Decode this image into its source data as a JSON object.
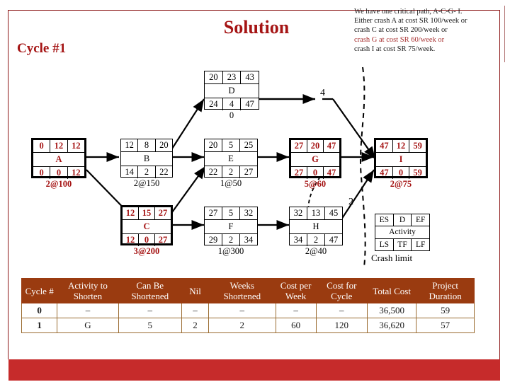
{
  "slide": {
    "title": "Solution",
    "cycle_label": "Cycle #1",
    "accent_red": "#a51414",
    "table_header_bg": "#9a3b10",
    "bottom_bar_color": "#c62b2b"
  },
  "note": {
    "line1": "We have one critical path, A-C-G- I.",
    "line2": "Either crash A at cost SR 100/week  or",
    "line3": "crash C  at cost SR 200/week or",
    "line4": "crash G  at cost SR 60/week or",
    "line5": "crash I at cost SR 75/week."
  },
  "legend": {
    "es": "ES",
    "d": "D",
    "ef": "EF",
    "activity": "Activity",
    "ls": "LS",
    "tf": "TF",
    "lf": "LF",
    "caption": "Crash limit"
  },
  "edge_labels": {
    "top": "4",
    "bottom": "2"
  },
  "nodes": [
    {
      "id": "D",
      "critical": false,
      "top": [
        "20",
        "23",
        "43"
      ],
      "name": "D",
      "bottom": [
        "24",
        "4",
        "47"
      ],
      "caption": "0"
    },
    {
      "id": "A",
      "critical": true,
      "top": [
        "0",
        "12",
        "12"
      ],
      "name": "A",
      "bottom": [
        "0",
        "0",
        "12"
      ],
      "caption": "2@100"
    },
    {
      "id": "B",
      "critical": false,
      "top": [
        "12",
        "8",
        "20"
      ],
      "name": "B",
      "bottom": [
        "14",
        "2",
        "22"
      ],
      "caption": "2@150"
    },
    {
      "id": "E",
      "critical": false,
      "top": [
        "20",
        "5",
        "25"
      ],
      "name": "E",
      "bottom": [
        "22",
        "2",
        "27"
      ],
      "caption": "1@50"
    },
    {
      "id": "G",
      "critical": true,
      "top": [
        "27",
        "20",
        "47"
      ],
      "name": "G",
      "bottom": [
        "27",
        "0",
        "47"
      ],
      "caption": "5@60"
    },
    {
      "id": "I",
      "critical": true,
      "top": [
        "47",
        "12",
        "59"
      ],
      "name": "I",
      "bottom": [
        "47",
        "0",
        "59"
      ],
      "caption": "2@75"
    },
    {
      "id": "C",
      "critical": true,
      "top": [
        "12",
        "15",
        "27"
      ],
      "name": "C",
      "bottom": [
        "12",
        "0",
        "27"
      ],
      "caption": "3@200"
    },
    {
      "id": "F",
      "critical": false,
      "top": [
        "27",
        "5",
        "32"
      ],
      "name": "F",
      "bottom": [
        "29",
        "2",
        "34"
      ],
      "caption": "1@300"
    },
    {
      "id": "H",
      "critical": false,
      "top": [
        "32",
        "13",
        "45"
      ],
      "name": "H",
      "bottom": [
        "34",
        "2",
        "47"
      ],
      "caption": "2@40"
    }
  ],
  "table": {
    "headers": [
      "Cycle #",
      "Activity to Shorten",
      "Can Be Shortened",
      "Nil",
      "Weeks Shortened",
      "Cost per Week",
      "Cost for Cycle",
      "Total Cost",
      "Project Duration"
    ],
    "rows": [
      [
        "0",
        "–",
        "–",
        "–",
        "–",
        "–",
        "–",
        "36,500",
        "59"
      ],
      [
        "1",
        "G",
        "5",
        "2",
        "2",
        "60",
        "120",
        "36,620",
        "57"
      ]
    ]
  }
}
